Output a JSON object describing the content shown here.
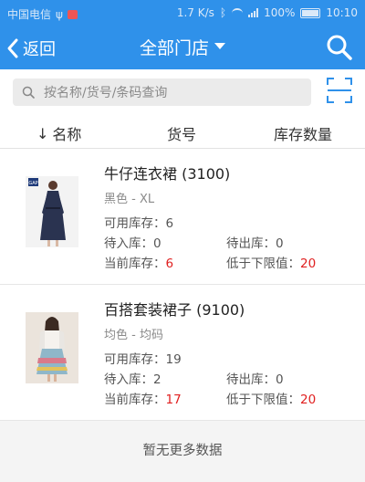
{
  "status_bar": {
    "carrier": "中国电信",
    "speed": "1.7 K/s",
    "battery": "100%",
    "time": "10:10"
  },
  "nav": {
    "back_label": "返回",
    "title": "全部门店",
    "icons": [
      "chevron-left-icon",
      "caret-down-icon",
      "search-icon"
    ]
  },
  "search": {
    "placeholder": "按名称/货号/条码查询",
    "value": "",
    "icons": [
      "search-icon",
      "scan-icon"
    ]
  },
  "columns": {
    "name": "名称",
    "sku": "货号",
    "stock": "库存数量"
  },
  "products": [
    {
      "name": "牛仔连衣裙 (3100)",
      "variant": "黑色 - XL",
      "available_label": "可用库存：",
      "available_value": "6",
      "incoming_label": "待入库：",
      "incoming_value": "0",
      "outgoing_label": "待出库：",
      "outgoing_value": "0",
      "current_label": "当前库存：",
      "current_value": "6",
      "below_label": "低于下限值：",
      "below_value": "20",
      "thumb_brand": "GAP"
    },
    {
      "name": "百搭套装裙子 (9100)",
      "variant": "均色 - 均码",
      "available_label": "可用库存：",
      "available_value": "19",
      "incoming_label": "待入库：",
      "incoming_value": "2",
      "outgoing_label": "待出库：",
      "outgoing_value": "0",
      "current_label": "当前库存：",
      "current_value": "17",
      "below_label": "低于下限值：",
      "below_value": "20"
    }
  ],
  "footer": {
    "message": "暂无更多数据"
  },
  "colors": {
    "primary": "#2f91ea",
    "alert": "#e02020"
  }
}
